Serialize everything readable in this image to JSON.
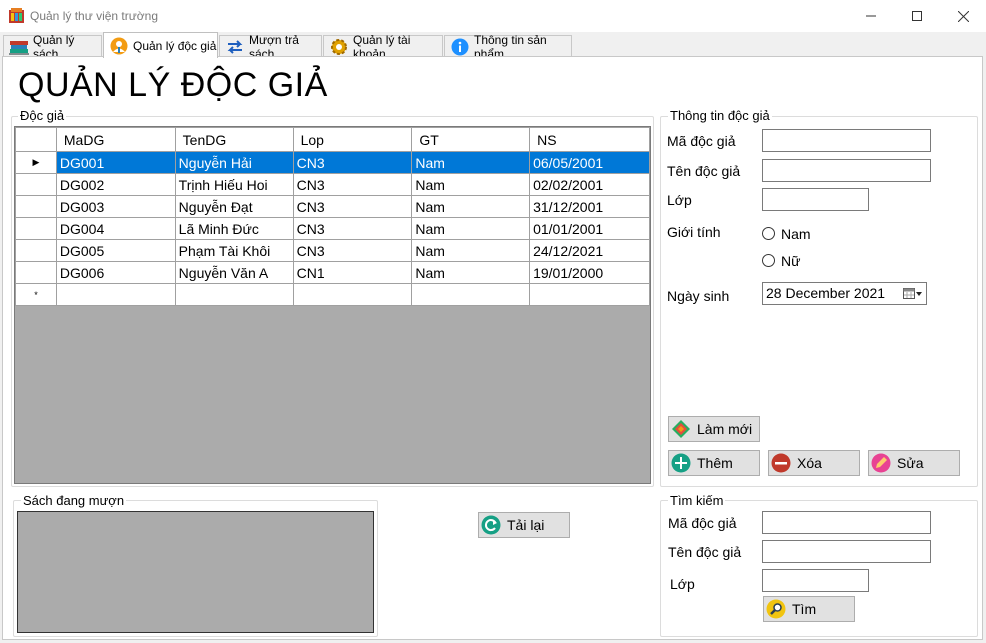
{
  "window": {
    "title": "Quản lý thư viện trường"
  },
  "tabs": [
    {
      "label": "Quản lý sách",
      "icon": "books-icon"
    },
    {
      "label": "Quản lý độc giả",
      "icon": "reader-icon"
    },
    {
      "label": "Mượn trả sách",
      "icon": "exchange-arrows-icon"
    },
    {
      "label": "Quản lý tài khoản",
      "icon": "gear-icon"
    },
    {
      "label": "Thông tin sản phẩm",
      "icon": "info-icon"
    }
  ],
  "page_title": "QUẢN LÝ ĐỘC GIẢ",
  "readers_group": {
    "label": "Độc giả",
    "columns": [
      "MaDG",
      "TenDG",
      "Lop",
      "GT",
      "NS"
    ],
    "rows": [
      [
        "DG001",
        "Nguyễn Hải",
        "CN3",
        "Nam",
        "06/05/2001"
      ],
      [
        "DG002",
        "Trịnh Hiếu Hoi",
        "CN3",
        "Nam",
        "02/02/2001"
      ],
      [
        "DG003",
        "Nguyễn Đạt",
        "CN3",
        "Nam",
        "31/12/2001"
      ],
      [
        "DG004",
        "Lã Minh Đức",
        "CN3",
        "Nam",
        "01/01/2001"
      ],
      [
        "DG005",
        "Phạm Tài Khôi",
        "CN3",
        "Nam",
        "24/12/2021"
      ],
      [
        "DG006",
        "Nguyễn Văn A",
        "CN1",
        "Nam",
        "19/01/2000"
      ]
    ],
    "selected_row": 0,
    "new_row_marker": "*",
    "current_row_marker": "▶"
  },
  "info_group": {
    "label": "Thông tin độc giả",
    "ma_label": "Mã độc giả",
    "ten_label": "Tên độc giả",
    "lop_label": "Lớp",
    "gioitinh_label": "Giới tính",
    "nam_label": "Nam",
    "nu_label": "Nữ",
    "ngaysinh_label": "Ngày sinh",
    "ngaysinh_value": "28 December 2021",
    "ma_value": "",
    "ten_value": "",
    "lop_value": ""
  },
  "buttons": {
    "lam_moi": "Làm mới",
    "them": "Thêm",
    "xoa": "Xóa",
    "sua": "Sửa",
    "tai_lai": "Tải lại",
    "tim": "Tìm"
  },
  "borrowing_group": {
    "label": "Sách đang mượn"
  },
  "search_group": {
    "label": "Tìm kiếm",
    "ma_label": "Mã độc giả",
    "ten_label": "Tên độc giả",
    "lop_label": "Lớp",
    "ma_value": "",
    "ten_value": "",
    "lop_value": ""
  },
  "colors": {
    "selection": "#0078d7",
    "grid_background": "#ababab",
    "button_face": "#e1e1e1"
  }
}
